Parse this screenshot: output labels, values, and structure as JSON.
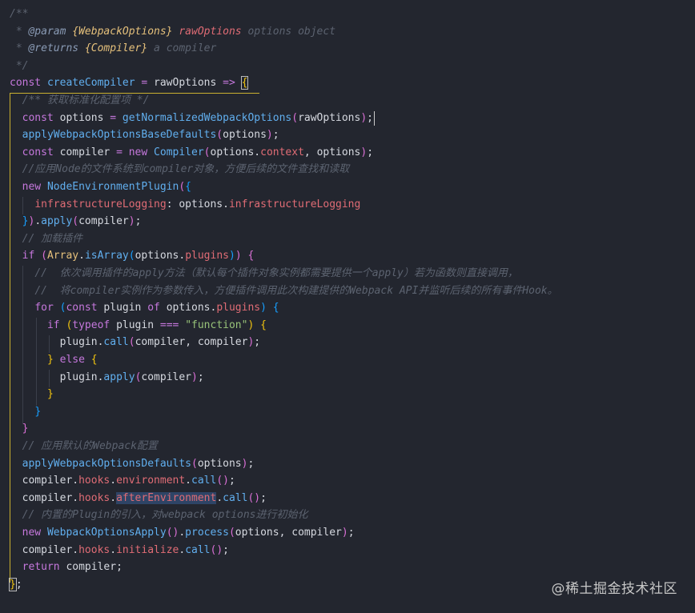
{
  "editor": {
    "background": "#23262f",
    "lines": [
      "/**",
      " * @param {WebpackOptions} rawOptions options object",
      " * @returns {Compiler} a compiler",
      " */",
      "const createCompiler = rawOptions => {",
      "  /** 获取标准化配置项 */",
      "  const options = getNormalizedWebpackOptions(rawOptions);",
      "  applyWebpackOptionsBaseDefaults(options);",
      "  const compiler = new Compiler(options.context, options);",
      "  //应用Node的文件系统到compiler对象，方便后续的文件查找和读取",
      "  new NodeEnvironmentPlugin({",
      "    infrastructureLogging: options.infrastructureLogging",
      "  }).apply(compiler);",
      "  // 加载插件",
      "  if (Array.isArray(options.plugins)) {",
      "    //  依次调用插件的apply方法（默认每个插件对象实例都需要提供一个apply）若为函数则直接调用，",
      "    //  将compiler实例作为参数传入，方便插件调用此次构建提供的Webpack API并监听后续的所有事件Hook。",
      "    for (const plugin of options.plugins) {",
      "      if (typeof plugin === \"function\") {",
      "        plugin.call(compiler, compiler);",
      "      } else {",
      "        plugin.apply(compiler);",
      "      }",
      "    }",
      "  }",
      "  // 应用默认的Webpack配置",
      "  applyWebpackOptionsDefaults(options);",
      "  compiler.hooks.environment.call();",
      "  compiler.hooks.afterEnvironment.call();",
      "  // 内置的Plugin的引入，对webpack options进行初始化",
      "  new WebpackOptionsApply().process(options, compiler);",
      "  compiler.hooks.initialize.call();",
      "  return compiler;",
      "};"
    ]
  },
  "watermark": "@稀土掘金技术社区"
}
